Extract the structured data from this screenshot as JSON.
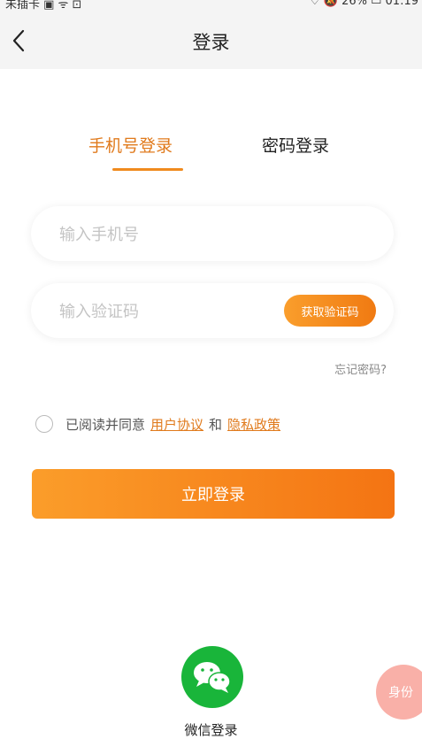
{
  "status_bar": {
    "left_text": "未插卡 ▣ ᯤ ⊡",
    "right_text": "♡ 🔕 26% ▭ 01:19"
  },
  "nav": {
    "title": "登录",
    "back_icon": "chevron-left-icon"
  },
  "tabs": [
    {
      "label": "手机号登录",
      "active": true
    },
    {
      "label": "密码登录",
      "active": false
    }
  ],
  "form": {
    "phone_placeholder": "输入手机号",
    "code_placeholder": "输入验证码",
    "get_code_label": "获取验证码",
    "forgot_label": "忘记密码?"
  },
  "agreement": {
    "prefix": "已阅读并同意",
    "user_agreement": "用户协议",
    "and": "和",
    "privacy_policy": "隐私政策"
  },
  "login_button_label": "立即登录",
  "wechat": {
    "label": "微信登录",
    "icon": "wechat-icon"
  },
  "floating_button_label": "身份",
  "colors": {
    "accent": "#f08a1e",
    "wechat_green": "#19b53a"
  }
}
